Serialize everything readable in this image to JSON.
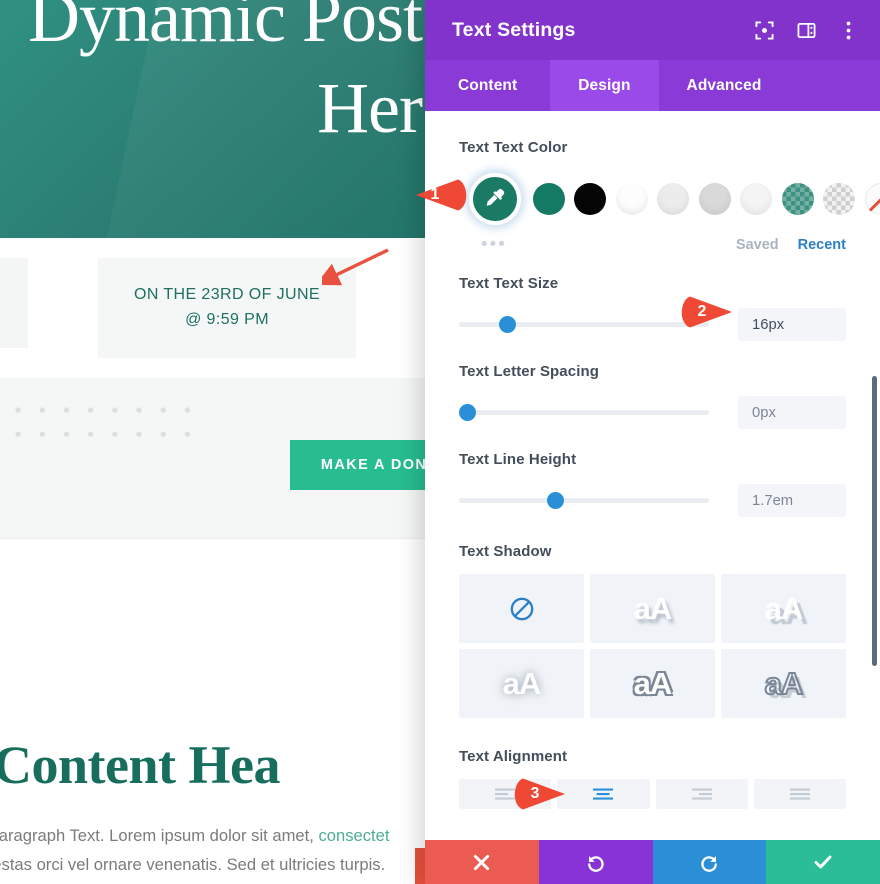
{
  "preview": {
    "hero_title_line1": "Dynamic Post",
    "hero_title_line2": "Her",
    "date_line1": "ON THE 23RD OF JUNE",
    "date_line2": "@ 9:59 PM",
    "donate_button": "MAKE A DONA",
    "content_heading": "st Content Hea",
    "paragraph_line1_pre": "ent Paragraph Text. Lorem ipsum dolor sit amet, ",
    "paragraph_line1_link": "consectet",
    "paragraph_line2": "n egestas orci vel ornare venenatis. Sed et ultricies turpis."
  },
  "panel": {
    "title": "Text Settings",
    "header_icons": [
      {
        "name": "focus-target-icon"
      },
      {
        "name": "layout-panel-icon"
      },
      {
        "name": "more-options-icon"
      }
    ],
    "tabs": [
      {
        "label": "Content",
        "active": false
      },
      {
        "label": "Design",
        "active": true
      },
      {
        "label": "Advanced",
        "active": false
      }
    ],
    "color": {
      "label": "Text Text Color",
      "active_swatch": "#1a7a63",
      "swatches": [
        "#157a63",
        "#050505",
        "#fdfdfd",
        "#ececec",
        "#d9d9d9",
        "#f4f4f4",
        "checker-teal",
        "checker-gray",
        "none"
      ],
      "saved_label": "Saved",
      "recent_label": "Recent",
      "more_label": "•••"
    },
    "text_size": {
      "label": "Text Text Size",
      "value": "16px",
      "slider_percent": 16
    },
    "letter_spacing": {
      "label": "Text Letter Spacing",
      "value": "0px",
      "slider_percent": 0
    },
    "line_height": {
      "label": "Text Line Height",
      "value": "1.7em",
      "slider_percent": 36
    },
    "text_shadow": {
      "label": "Text Shadow",
      "options": [
        {
          "name": "none",
          "glyph": ""
        },
        {
          "name": "soft-drop",
          "glyph": "aA"
        },
        {
          "name": "hard-drop",
          "glyph": "aA"
        },
        {
          "name": "glow",
          "glyph": "aA"
        },
        {
          "name": "outline",
          "glyph": "aA"
        },
        {
          "name": "stroke-offset",
          "glyph": "aA"
        }
      ]
    },
    "text_alignment": {
      "label": "Text Alignment",
      "options": [
        {
          "name": "align-left",
          "active": false
        },
        {
          "name": "align-center",
          "active": true
        },
        {
          "name": "align-right",
          "active": false
        },
        {
          "name": "align-justify",
          "active": false
        }
      ]
    },
    "actions": [
      {
        "name": "cancel",
        "color": "#ec5b51"
      },
      {
        "name": "undo",
        "color": "#8833d8"
      },
      {
        "name": "redo",
        "color": "#2b8fd8"
      },
      {
        "name": "save",
        "color": "#2bbd98"
      }
    ]
  },
  "callouts": [
    {
      "number": "1"
    },
    {
      "number": "2"
    },
    {
      "number": "3"
    }
  ],
  "colors": {
    "brand_purple": "#8233cc",
    "tab_purple": "#8a3ad6",
    "tab_active_purple": "#9a4ae8",
    "accent_blue": "#2b8fd8",
    "hero_teal": "#2c7f74",
    "heading_green": "#176e5d",
    "donate_green": "#27bd91",
    "callout_red": "#ef4936"
  }
}
